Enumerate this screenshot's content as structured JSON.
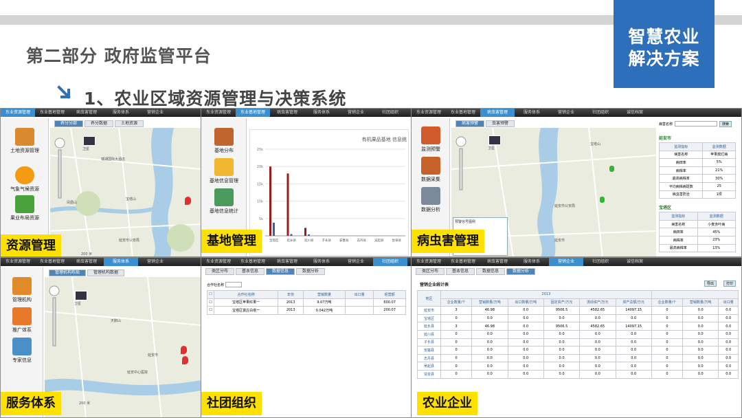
{
  "header": {
    "brand_line1": "智慧农业",
    "brand_line2": "解决方案",
    "part_title": "第二部分  政府监管平台",
    "sub_title": "1、农业区域资源管理与决策系统"
  },
  "nav_tabs": [
    "东业资源管理",
    "东业基地管理",
    "病虫害管理",
    "服务体系",
    "营销企业",
    "社团组织",
    "诚信档案"
  ],
  "panel_resource": {
    "caption": "资源管理",
    "tabs": [
      "养分分部",
      "养分数据",
      "土地资源"
    ],
    "side": [
      "土地资源管理",
      "气象气候资源",
      "果业布局资源"
    ],
    "map_labels": [
      "瑞湖国际大酒店",
      "凤凰山",
      "宝塔山",
      "延安市公安局",
      "卫星"
    ],
    "scale": "200 米"
  },
  "panel_base": {
    "caption": "基地管理",
    "side": [
      "基地分布",
      "基地信息管理",
      "基地信息统计"
    ]
  },
  "panel_pest": {
    "caption": "病虫害管理",
    "tabs": [
      "病害预警",
      "虫害预警"
    ],
    "side": [
      "监测预警",
      "数据采集",
      "数据分析"
    ],
    "search_label": "病害名称",
    "search_button": "搜索",
    "popup_title": "预警信号图例",
    "map_labels": [
      "宝塔山",
      "延安市公安局",
      "延安市",
      "卫星"
    ],
    "groups": [
      {
        "name": "延安市",
        "header": [
          "监测指标",
          "监测数据"
        ],
        "rows": [
          [
            "病害名称",
            "苹果腐烂病"
          ],
          [
            "病田率",
            "5%"
          ],
          [
            "病株率",
            "21%"
          ],
          [
            "最高病株率",
            "30%"
          ],
          [
            "平均病株病斑数",
            "25"
          ],
          [
            "病虫害防治",
            "1项"
          ]
        ]
      },
      {
        "name": "宝塔区",
        "header": [
          "监测指标",
          "监测数据"
        ],
        "rows": [
          [
            "病害名称",
            "小麦赤叶病"
          ],
          [
            "病田率",
            "45%"
          ],
          [
            "病株率",
            "23%"
          ],
          [
            "最高病株率",
            "13%"
          ]
        ]
      }
    ]
  },
  "panel_service": {
    "caption": "服务体系",
    "tabs": [
      "管理机构布局",
      "管理机构数据"
    ],
    "side": [
      "管理机构",
      "推广体系",
      "专家信息"
    ],
    "map_labels": [
      "天鹅山",
      "延安市",
      "延安中心医院",
      "卫星"
    ],
    "scale": "200 米"
  },
  "panel_org": {
    "caption": "社团组织",
    "tabs": [
      "类区分布",
      "基本信息",
      "数据信息",
      "数据分析"
    ],
    "search_label": "合作社名称",
    "columns": [
      "合作社名称",
      "年份",
      "营销数量",
      "出口量",
      "经营额"
    ],
    "rows": [
      [
        "宝塔区苹果红果一",
        "2013",
        "9.07万吨",
        "",
        "600.07"
      ],
      [
        "宝塔区富庄白塔一",
        "2013",
        "0.042万吨",
        "",
        "200.07"
      ]
    ]
  },
  "panel_enterprise": {
    "caption": "农业企业",
    "tabs": [
      "类区分布",
      "基本信息",
      "数据信息",
      "数据分析"
    ],
    "table_title": "营销企业统计表",
    "btn1": "导出",
    "btn2": "打印",
    "year": "2013",
    "corner": "地区",
    "columns": [
      "企业数量/个",
      "营销数量/万吨",
      "出口数量/万吨",
      "固定资产/万元",
      "流动资产/万元",
      "资产总额/万元",
      "企业数量/个",
      "营销数量/万吨",
      "出口量"
    ],
    "rows": [
      [
        "延安市",
        "3",
        "46.98",
        "0.0",
        "9506.5",
        "4582.65",
        "14097.15",
        "0",
        "0.0",
        "0.0"
      ],
      [
        "宝塔区",
        "0",
        "0.0",
        "0.0",
        "0.0",
        "0.0",
        "0.0",
        "0",
        "0.0",
        "0.0"
      ],
      [
        "延长县",
        "3",
        "46.98",
        "0.0",
        "9506.5",
        "4582.65",
        "14097.15",
        "0",
        "0.0",
        "0.0"
      ],
      [
        "延川县",
        "0",
        "0.0",
        "0.0",
        "0.0",
        "0.0",
        "0.0",
        "0",
        "0.0",
        "0.0"
      ],
      [
        "子长县",
        "0",
        "0.0",
        "0.0",
        "0.0",
        "0.0",
        "0.0",
        "0",
        "0.0",
        "0.0"
      ],
      [
        "安塞县",
        "0",
        "0.0",
        "0.0",
        "0.0",
        "0.0",
        "0.0",
        "0",
        "0.0",
        "0.0"
      ],
      [
        "志丹县",
        "0",
        "0.0",
        "0.0",
        "0.0",
        "0.0",
        "0.0",
        "0",
        "0.0",
        "0.0"
      ],
      [
        "吴起县",
        "0",
        "0.0",
        "0.0",
        "0.0",
        "0.0",
        "0.0",
        "0",
        "0.0",
        "0.0"
      ],
      [
        "甘泉县",
        "0",
        "0.0",
        "0.0",
        "0.0",
        "0.0",
        "0.0",
        "0",
        "0.0",
        "0.0"
      ]
    ]
  },
  "chart_data": {
    "type": "bar",
    "title": "有机果品基地 信息统",
    "categories": [
      "宝塔区",
      "延长县",
      "延川县",
      "子长县",
      "安塞县",
      "志丹县",
      "吴起县",
      "甘泉县"
    ],
    "series": [
      {
        "values": [
          20000,
          18000,
          2300,
          0,
          0,
          0,
          0,
          0
        ],
        "color": "#9b1c1c"
      },
      {
        "values": [
          3800,
          500,
          400,
          0,
          0,
          0,
          0,
          0
        ],
        "color": "#3d5fa0"
      }
    ],
    "yticks": [
      "5k",
      "10k",
      "15k",
      "20k",
      "25k"
    ],
    "ylim": [
      0,
      25000
    ]
  }
}
